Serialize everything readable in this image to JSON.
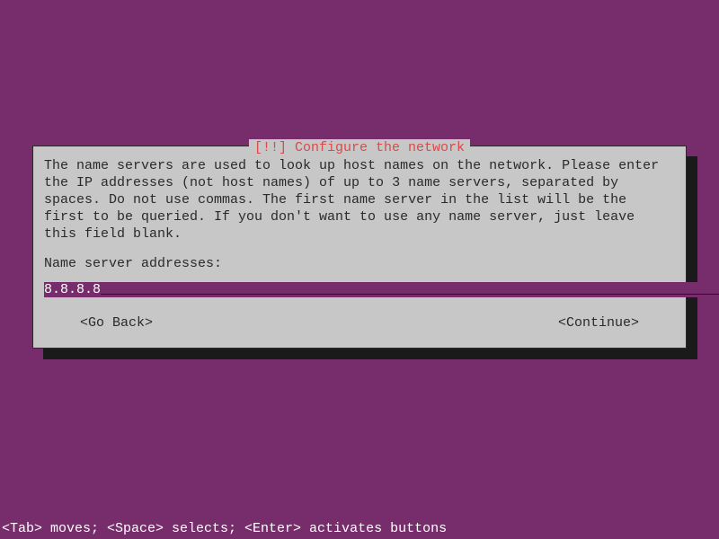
{
  "dialog": {
    "priority_prefix": "[!!]",
    "title": "Configure the network",
    "description": "The name servers are used to look up host names on the network. Please enter the IP addresses (not host names) of up to 3 name servers, separated by spaces. Do not use commas. The first name server in the list will be the first to be queried. If you don't want to use any name server, just leave this field blank.",
    "field_label": "Name server addresses:",
    "input_value": "8.8.8.8",
    "back_label": "<Go Back>",
    "continue_label": "<Continue>"
  },
  "footer": {
    "hint": "<Tab> moves; <Space> selects; <Enter> activates buttons"
  }
}
